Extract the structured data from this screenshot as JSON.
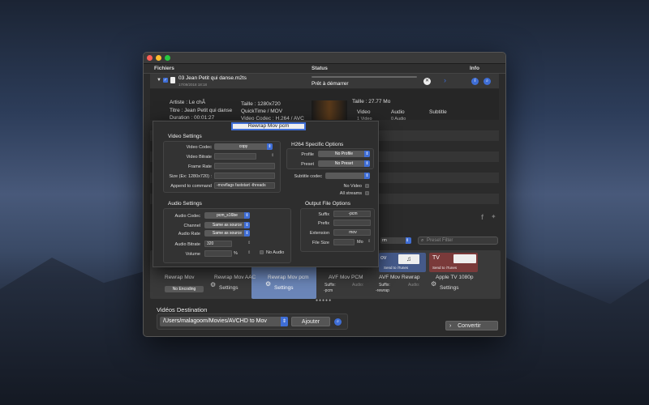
{
  "columns": {
    "files": "Fichiers",
    "status": "Status",
    "info": "Info"
  },
  "file": {
    "name": "03 Jean Petit qui danse.m2ts",
    "date": "17/09/2018 18:18",
    "status": "Prêt à démarrer",
    "artist": "Artiste : Le chÃ",
    "title": "Titre : Jean Petit qui danse",
    "duration": "Duration : 00:01:27",
    "size_px": "Taille : 1280x720",
    "container": "QuickTime / MOV",
    "codec": "Video Codec : H.264 / AVC",
    "size_mb": "Taille : 27.77 Mo",
    "col_video": "Video",
    "col_audio": "Audio",
    "col_subtitle": "Subtitle",
    "video_count": "1 Video",
    "audio_count": "0 Audio"
  },
  "dialog": {
    "title": "Rewrap Mov pcm",
    "video_settings": "Video Settings",
    "video_codec_label": "Video Codec",
    "video_codec": "copy",
    "video_bitrate_label": "Video Bitrate",
    "frame_rate_label": "Frame Rate",
    "size_label": "Size (Ex: 1280x720) :",
    "append_label": "Append to command",
    "append_value": "-movflags faststart -threads",
    "h264_title": "H264 Specific Options",
    "profile_label": "Profile",
    "profile": "No Profile",
    "preset_label": "Preset",
    "preset": "No Preset",
    "subtitle_codec_label": "Subtitle codec",
    "no_video": "No Video",
    "all_streams": "All streams",
    "audio_settings": "Audio Settings",
    "audio_codec_label": "Audio Codec",
    "audio_codec": "pcm_s16be",
    "channel_label": "Channel",
    "channel": "Same as source",
    "audio_rate_label": "Audio Rate",
    "audio_rate": "Same as source",
    "audio_bitrate_label": "Audio Bitrate",
    "audio_bitrate": "320",
    "volume_label": "Volume",
    "volume_unit": "%",
    "no_audio": "No Audio",
    "output_title": "Output File Options",
    "suffix_label": "Suffix",
    "suffix": "-pcm",
    "prefix_label": "Prefix",
    "extension_label": "Extension",
    "extension": "mov",
    "file_size_label": "File Size",
    "file_size_unit": "Mo"
  },
  "toolbar": {
    "search_placeholder": "Preset Filter",
    "popup_value": "rm"
  },
  "presets": [
    {
      "name": "Rewrap Mov",
      "badge": "No Encoding"
    },
    {
      "name": "Rewrap Mov AAC",
      "settings": "Settings"
    },
    {
      "name": "Rewrap Mov pcm",
      "settings": "Settings"
    },
    {
      "name": "AVF Mov PCM",
      "suffix": "Suffix:",
      "suffix_val": "-pcm",
      "audio": "Audio:"
    },
    {
      "name": "AVF Mov Rewrap",
      "suffix": "Suffix:",
      "suffix_val": "-rewrap",
      "audio": "Audio:",
      "itunes": "Send to iTunes",
      "mov": "ov"
    },
    {
      "name": "Apple TV 1080p",
      "settings": "Settings",
      "tv": "TV",
      "itunes": "Send to iTunes"
    }
  ],
  "destination": {
    "title": "Vidéos Destination",
    "path": "/Users/malagoom/Movies/AVCHD to Mov",
    "add": "Ajouter"
  },
  "convert": "Convertir",
  "colors": {
    "accent": "#3f6ed6",
    "window": "#2b2b2b",
    "selected": "#6b86b8"
  }
}
